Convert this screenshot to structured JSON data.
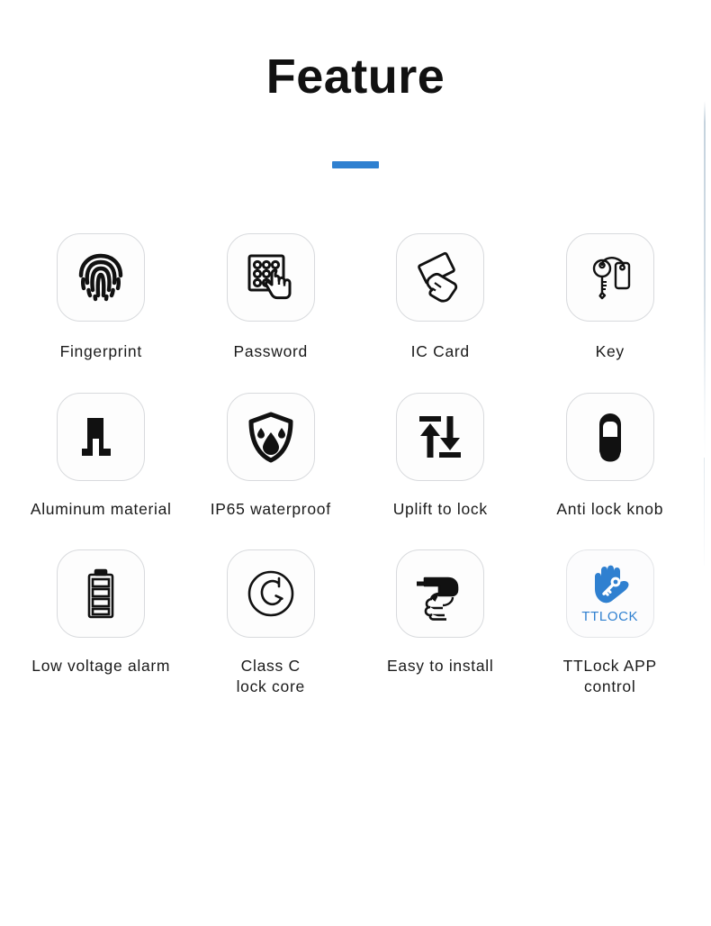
{
  "header": {
    "title": "Feature",
    "accent_color": "#2f80d0"
  },
  "features": [
    {
      "id": "fingerprint",
      "label": "Fingerprint",
      "icon": "fingerprint-icon"
    },
    {
      "id": "password",
      "label": "Password",
      "icon": "keypad-hand-icon"
    },
    {
      "id": "ic-card",
      "label": "IC Card",
      "icon": "card-hand-icon"
    },
    {
      "id": "key",
      "label": "Key",
      "icon": "key-fob-icon"
    },
    {
      "id": "aluminum",
      "label": "Aluminum material",
      "icon": "aluminum-block-icon"
    },
    {
      "id": "waterproof",
      "label": "IP65 waterproof",
      "icon": "shield-droplet-icon"
    },
    {
      "id": "uplift-lock",
      "label": "Uplift to lock",
      "icon": "up-down-arrows-icon"
    },
    {
      "id": "anti-lock-knob",
      "label": "Anti lock knob",
      "icon": "knob-capsule-icon"
    },
    {
      "id": "low-voltage",
      "label": "Low voltage alarm",
      "icon": "battery-icon"
    },
    {
      "id": "class-c-core",
      "label": "Class C\nlock core",
      "icon": "class-c-circle-icon"
    },
    {
      "id": "easy-install",
      "label": "Easy to install",
      "icon": "drill-hand-icon"
    },
    {
      "id": "ttlock-app",
      "label": "TTLock APP\ncontrol",
      "icon": "ttlock-hand-key-icon",
      "tile_word": "TTLOCK",
      "tile_color": "#2f80d0"
    }
  ]
}
